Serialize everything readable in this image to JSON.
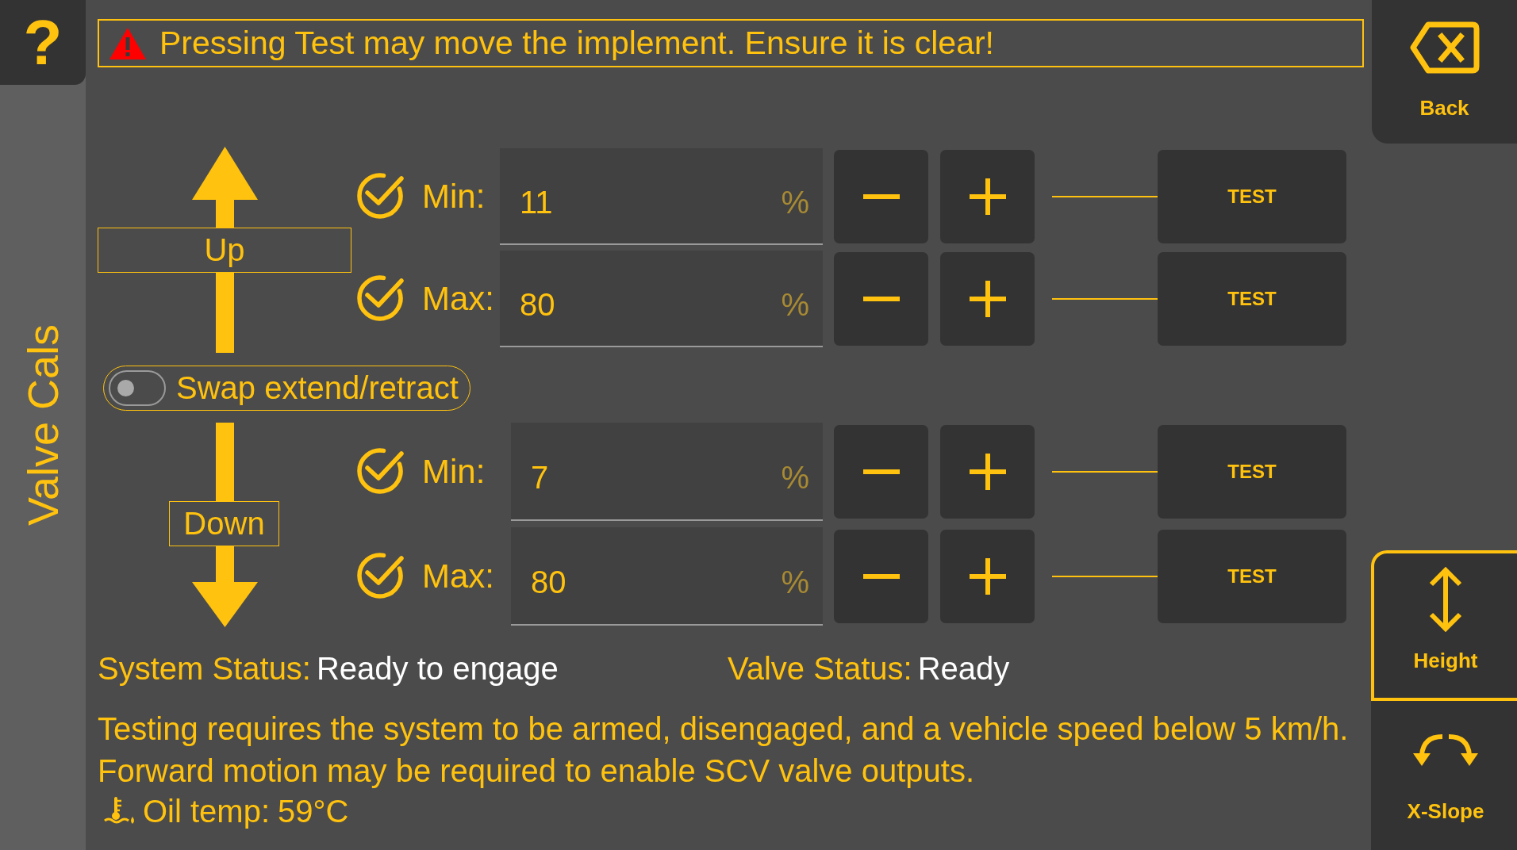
{
  "help_button": {
    "label": "?"
  },
  "sidebar": {
    "title": "Valve Cals"
  },
  "warning": {
    "text": "Pressing Test may move the implement. Ensure it is clear!"
  },
  "sections": [
    {
      "kind": "up",
      "label": "Up",
      "settings": [
        {
          "checked": true,
          "label": "Min:",
          "value": "11",
          "unit": "%",
          "test_label": "TEST"
        },
        {
          "checked": true,
          "label": "Max:",
          "value": "80",
          "unit": "%",
          "test_label": "TEST"
        }
      ]
    },
    {
      "kind": "toggle",
      "label": "Swap extend/retract",
      "on": false
    },
    {
      "kind": "down",
      "label": "Down",
      "settings": [
        {
          "checked": true,
          "label": "Min:",
          "value": "7",
          "unit": "%",
          "test_label": "TEST"
        },
        {
          "checked": true,
          "label": "Max:",
          "value": "80",
          "unit": "%",
          "test_label": "TEST"
        }
      ]
    }
  ],
  "status": [
    {
      "label": "System Status:",
      "value": "Ready to engage"
    },
    {
      "label": "Valve Status:",
      "value": "Ready"
    }
  ],
  "notes": [
    "Testing requires the system to be armed, disengaged, and a vehicle speed below 5 km/h.",
    "Forward motion may be required to enable SCV valve outputs."
  ],
  "oil_temp": {
    "label": "Oil temp:",
    "value": "59°C"
  },
  "back_button": {
    "label": "Back"
  },
  "modes": [
    {
      "kind": "height",
      "label": "Height",
      "selected": true
    },
    {
      "kind": "slope",
      "label": "X-Slope",
      "selected": false
    }
  ]
}
